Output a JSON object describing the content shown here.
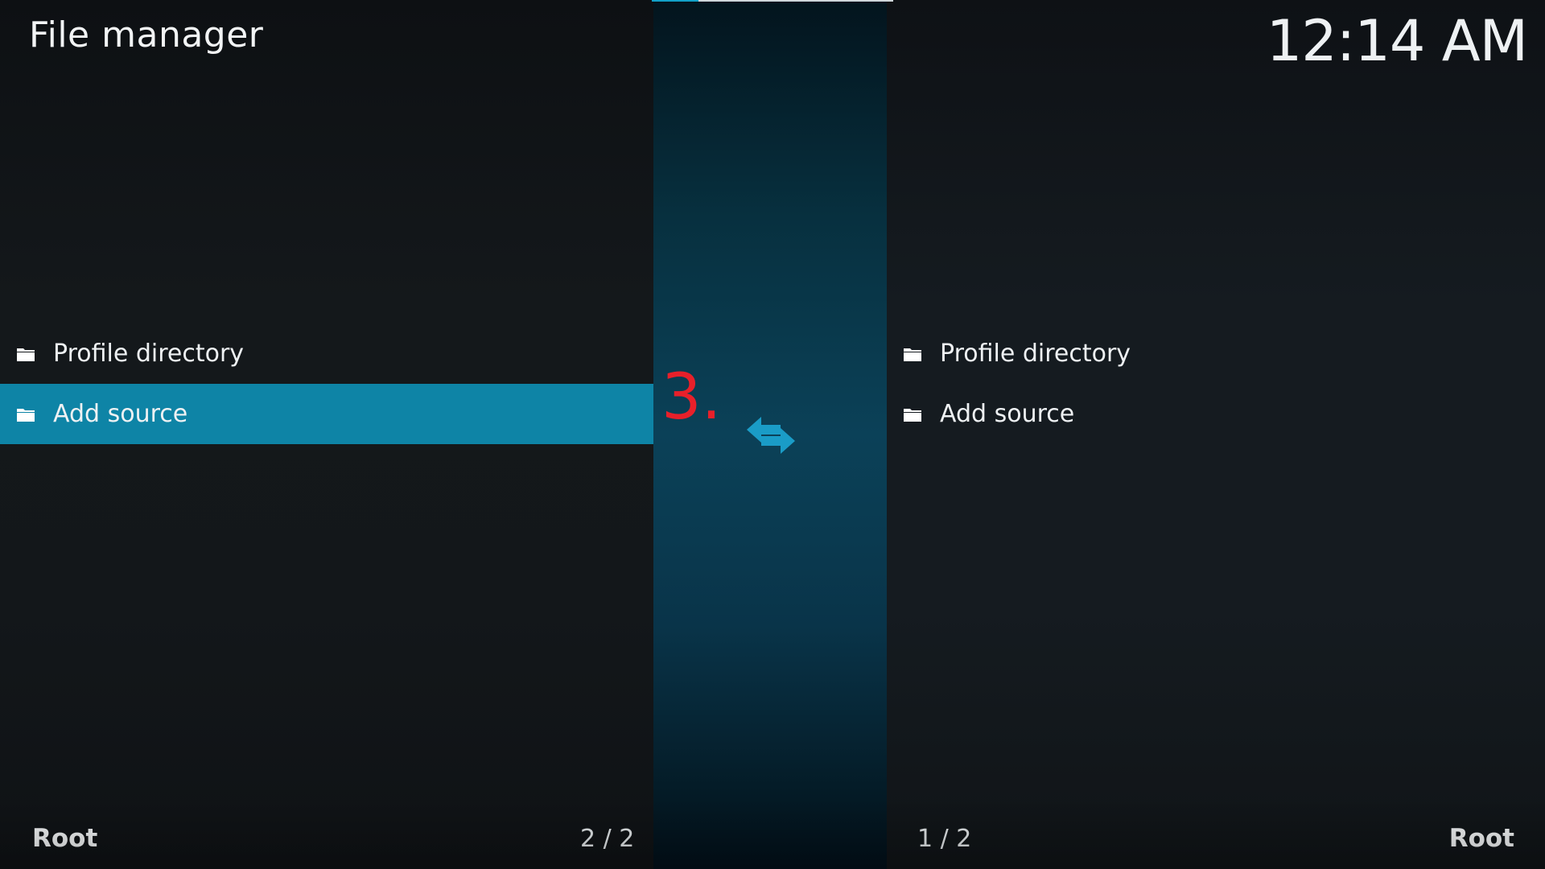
{
  "header": {
    "title": "File manager",
    "clock": "12:14 AM"
  },
  "left_panel": {
    "items": [
      {
        "label": "Profile directory",
        "icon": "folder-icon"
      },
      {
        "label": "Add source",
        "icon": "folder-icon",
        "selected": true
      }
    ],
    "footer_path": "Root",
    "footer_count": "2 / 2"
  },
  "right_panel": {
    "items": [
      {
        "label": "Profile directory",
        "icon": "folder-icon"
      },
      {
        "label": "Add source",
        "icon": "folder-icon"
      }
    ],
    "footer_path": "Root",
    "footer_count": "1 / 2"
  },
  "center": {
    "annotation": "3.",
    "swap_icon": "swap-arrows-icon"
  },
  "colors": {
    "accent": "#0e84a6",
    "icon_blue": "#1a9cc7",
    "annotation_red": "#e8202a"
  }
}
